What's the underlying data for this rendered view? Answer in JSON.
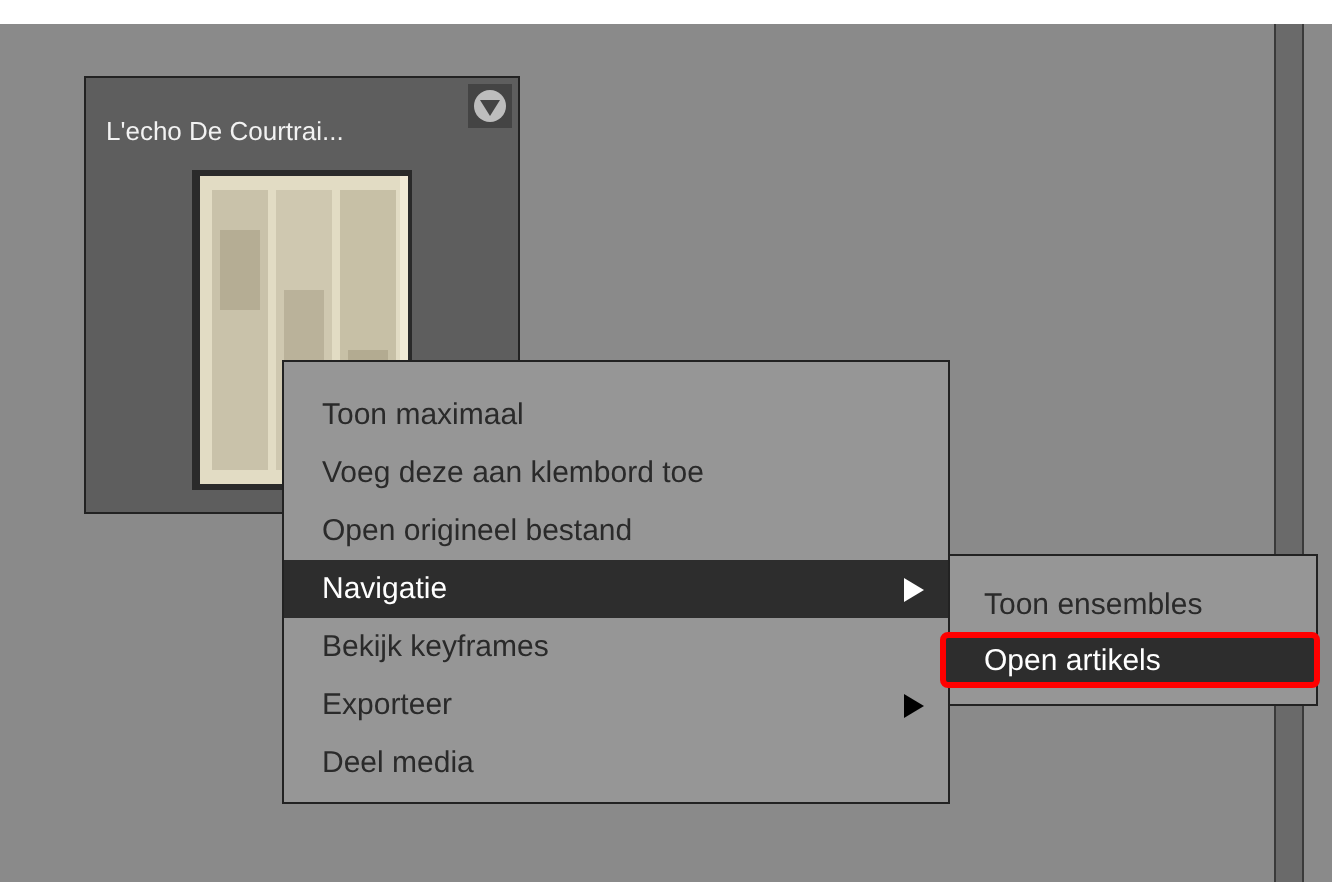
{
  "card": {
    "title": "L'echo De Courtrai..."
  },
  "context_menu": {
    "items": [
      {
        "label": "Toon maximaal",
        "has_submenu": false,
        "selected": false
      },
      {
        "label": "Voeg deze aan klembord toe",
        "has_submenu": false,
        "selected": false
      },
      {
        "label": "Open origineel bestand",
        "has_submenu": false,
        "selected": false
      },
      {
        "label": "Navigatie",
        "has_submenu": true,
        "selected": true
      },
      {
        "label": "Bekijk keyframes",
        "has_submenu": false,
        "selected": false
      },
      {
        "label": "Exporteer",
        "has_submenu": true,
        "selected": false
      },
      {
        "label": "Deel media",
        "has_submenu": false,
        "selected": false
      }
    ]
  },
  "submenu": {
    "items": [
      {
        "label": "Toon ensembles",
        "selected": false
      },
      {
        "label": "Open artikels",
        "selected": true
      }
    ]
  }
}
